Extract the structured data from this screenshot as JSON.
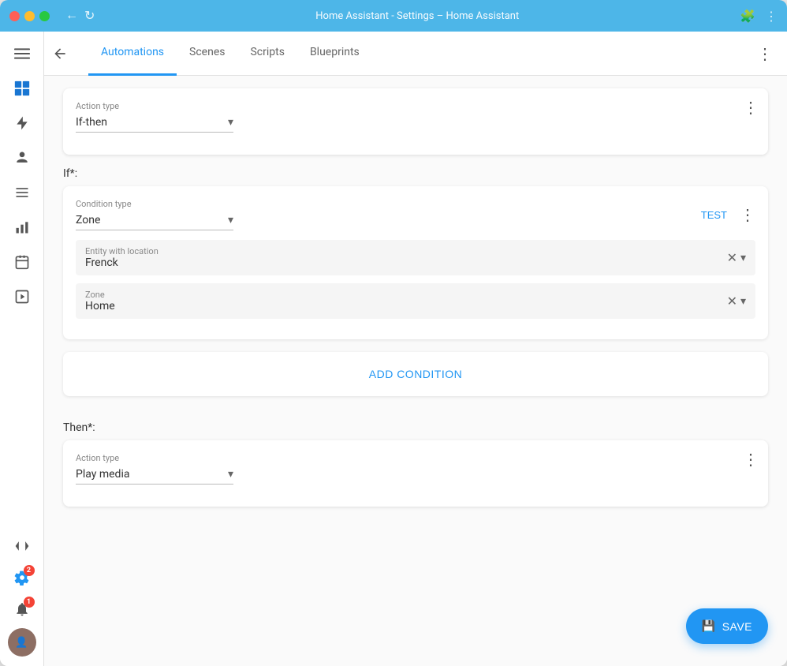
{
  "browser": {
    "title": "Home Assistant - Settings – Home Assistant"
  },
  "nav": {
    "back_icon": "←",
    "tabs": [
      "Automations",
      "Scenes",
      "Scripts",
      "Blueprints"
    ],
    "active_tab": "Automations"
  },
  "sidebar": {
    "icons": [
      {
        "name": "menu-icon",
        "symbol": "☰"
      },
      {
        "name": "dashboard-icon",
        "symbol": "⊞"
      },
      {
        "name": "energy-icon",
        "symbol": "⚡"
      },
      {
        "name": "person-icon",
        "symbol": "👤"
      },
      {
        "name": "list-icon",
        "symbol": "≡"
      },
      {
        "name": "chart-icon",
        "symbol": "▦"
      },
      {
        "name": "media-icon",
        "symbol": "▣"
      },
      {
        "name": "video-icon",
        "symbol": "▶"
      },
      {
        "name": "developer-icon",
        "symbol": "🔧"
      },
      {
        "name": "settings-icon",
        "symbol": "⚙",
        "badge": "2"
      }
    ],
    "notification_badge": "1",
    "avatar_text": "👤"
  },
  "action_type_card": {
    "label": "Action type",
    "value": "If-then"
  },
  "if_section": {
    "label": "If*:"
  },
  "condition_card": {
    "condition_type_label": "Condition type",
    "condition_type_value": "Zone",
    "test_label": "TEST",
    "entity_label": "Entity with location",
    "entity_value": "Frenck",
    "zone_label": "Zone",
    "zone_value": "Home"
  },
  "add_condition": {
    "label": "ADD CONDITION"
  },
  "then_section": {
    "label": "Then*:"
  },
  "action_card": {
    "label": "Action type",
    "value": "Play media"
  },
  "save_btn": {
    "label": "SAVE",
    "icon": "💾"
  }
}
